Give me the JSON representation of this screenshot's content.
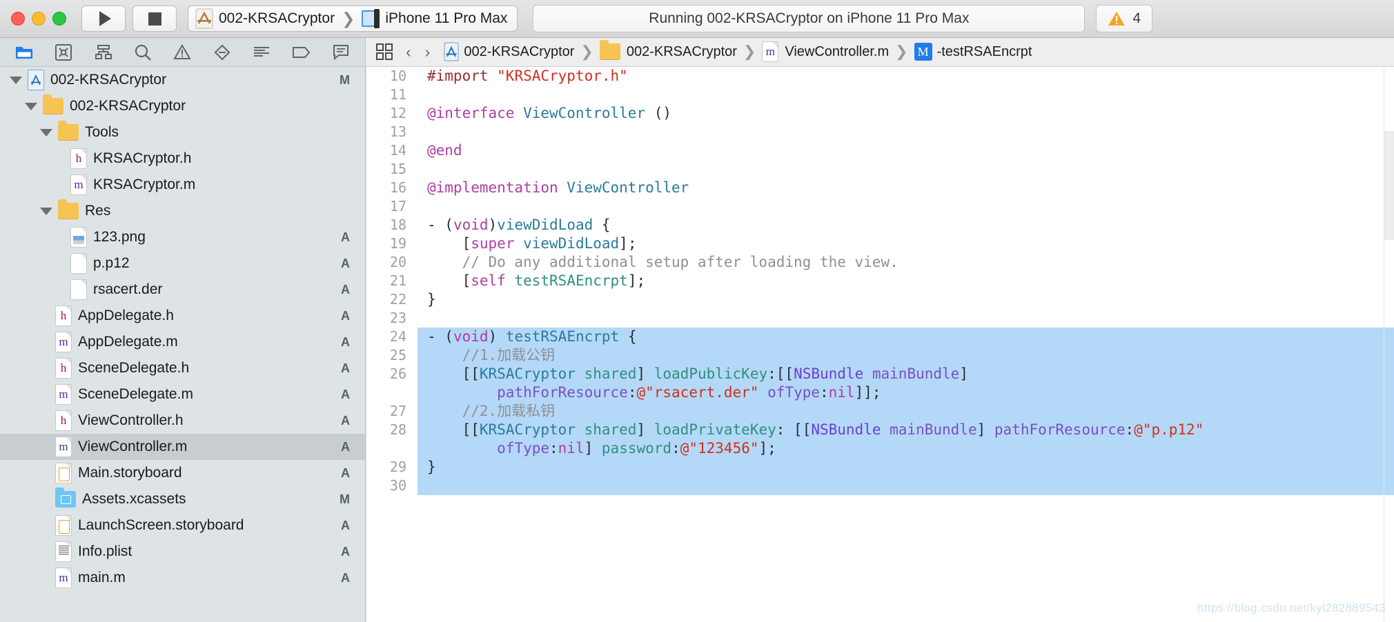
{
  "window": {
    "traffic_lights": [
      "close",
      "minimize",
      "zoom"
    ]
  },
  "toolbar": {
    "run_button": "run",
    "stop_button": "stop",
    "scheme_project": "002-KRSACryptor",
    "scheme_destination": "iPhone 11 Pro Max",
    "status_text": "Running 002-KRSACryptor on iPhone 11 Pro Max",
    "warning_count": "4"
  },
  "navigator_toolbar": {
    "icons": [
      {
        "name": "project-navigator-icon",
        "glyph": "folder",
        "active": true
      },
      {
        "name": "source-control-navigator-icon",
        "glyph": "scm",
        "active": false
      },
      {
        "name": "symbol-navigator-icon",
        "glyph": "hierarchy",
        "active": false
      },
      {
        "name": "find-navigator-icon",
        "glyph": "search",
        "active": false
      },
      {
        "name": "issue-navigator-icon",
        "glyph": "warning",
        "active": false
      },
      {
        "name": "test-navigator-icon",
        "glyph": "diamond",
        "active": false
      },
      {
        "name": "debug-navigator-icon",
        "glyph": "lines",
        "active": false
      },
      {
        "name": "breakpoint-navigator-icon",
        "glyph": "tag",
        "active": false
      },
      {
        "name": "report-navigator-icon",
        "glyph": "speech",
        "active": false
      }
    ]
  },
  "breadcrumb": {
    "back_label": "‹",
    "forward_label": "›",
    "items": [
      {
        "label": "002-KRSACryptor",
        "icon": "xcode-project-icon"
      },
      {
        "label": "002-KRSACryptor",
        "icon": "folder-icon"
      },
      {
        "label": "ViewController.m",
        "icon": "objc-m-file-icon"
      },
      {
        "label": "-testRSAEncrpt",
        "icon": "method-m-icon"
      }
    ]
  },
  "sidebar": {
    "rows": [
      {
        "label": "002-KRSACryptor",
        "indent": 0,
        "icon": "xcode-project-icon",
        "twisty": "open",
        "status": "M"
      },
      {
        "label": "002-KRSACryptor",
        "indent": 1,
        "icon": "folder-icon",
        "twisty": "open",
        "status": ""
      },
      {
        "label": "Tools",
        "indent": 2,
        "icon": "folder-icon",
        "twisty": "open",
        "status": ""
      },
      {
        "label": "KRSACryptor.h",
        "indent": 4,
        "icon": "header-h-file-icon",
        "twisty": "none",
        "status": ""
      },
      {
        "label": "KRSACryptor.m",
        "indent": 4,
        "icon": "objc-m-file-icon",
        "twisty": "none",
        "status": ""
      },
      {
        "label": "Res",
        "indent": 2,
        "icon": "folder-icon",
        "twisty": "open",
        "status": ""
      },
      {
        "label": "123.png",
        "indent": 4,
        "icon": "image-file-icon",
        "twisty": "none",
        "status": "A"
      },
      {
        "label": "p.p12",
        "indent": 4,
        "icon": "generic-file-icon",
        "twisty": "none",
        "status": "A"
      },
      {
        "label": "rsacert.der",
        "indent": 4,
        "icon": "generic-file-icon",
        "twisty": "none",
        "status": "A"
      },
      {
        "label": "AppDelegate.h",
        "indent": 3,
        "icon": "header-h-file-icon",
        "twisty": "none",
        "status": "A"
      },
      {
        "label": "AppDelegate.m",
        "indent": 3,
        "icon": "objc-m-file-icon",
        "twisty": "none",
        "status": "A"
      },
      {
        "label": "SceneDelegate.h",
        "indent": 3,
        "icon": "header-h-file-icon",
        "twisty": "none",
        "status": "A"
      },
      {
        "label": "SceneDelegate.m",
        "indent": 3,
        "icon": "objc-m-file-icon",
        "twisty": "none",
        "status": "A"
      },
      {
        "label": "ViewController.h",
        "indent": 3,
        "icon": "header-h-file-icon",
        "twisty": "none",
        "status": "A"
      },
      {
        "label": "ViewController.m",
        "indent": 3,
        "icon": "objc-m-file-icon",
        "twisty": "none",
        "status": "A",
        "selected": true
      },
      {
        "label": "Main.storyboard",
        "indent": 3,
        "icon": "storyboard-file-icon",
        "twisty": "none",
        "status": "A"
      },
      {
        "label": "Assets.xcassets",
        "indent": 3,
        "icon": "xcassets-folder-icon",
        "twisty": "none",
        "status": "M"
      },
      {
        "label": "LaunchScreen.storyboard",
        "indent": 3,
        "icon": "storyboard-file-icon",
        "twisty": "none",
        "status": "A"
      },
      {
        "label": "Info.plist",
        "indent": 3,
        "icon": "plist-file-icon",
        "twisty": "none",
        "status": "A"
      },
      {
        "label": "main.m",
        "indent": 3,
        "icon": "objc-m-file-icon",
        "twisty": "none",
        "status": "A"
      }
    ]
  },
  "editor": {
    "watermark": "https://blog.csdn.net/kyl282889543",
    "lines": [
      {
        "no": "10",
        "highlighted": false,
        "tokens": [
          {
            "t": "#import ",
            "c": "tok-pre"
          },
          {
            "t": "\"KRSACryptor.h\"",
            "c": "tok-str"
          }
        ]
      },
      {
        "no": "11",
        "highlighted": false,
        "tokens": []
      },
      {
        "no": "12",
        "highlighted": false,
        "tokens": [
          {
            "t": "@interface ",
            "c": "tok-key"
          },
          {
            "t": "ViewController",
            "c": "tok-type"
          },
          {
            "t": " ()",
            "c": "tok-plain"
          }
        ]
      },
      {
        "no": "13",
        "highlighted": false,
        "tokens": []
      },
      {
        "no": "14",
        "highlighted": false,
        "tokens": [
          {
            "t": "@end",
            "c": "tok-key"
          }
        ]
      },
      {
        "no": "15",
        "highlighted": false,
        "tokens": []
      },
      {
        "no": "16",
        "highlighted": false,
        "tokens": [
          {
            "t": "@implementation ",
            "c": "tok-key"
          },
          {
            "t": "ViewController",
            "c": "tok-type"
          }
        ]
      },
      {
        "no": "17",
        "highlighted": false,
        "tokens": []
      },
      {
        "no": "18",
        "highlighted": false,
        "tokens": [
          {
            "t": "- (",
            "c": "tok-plain"
          },
          {
            "t": "void",
            "c": "tok-key"
          },
          {
            "t": ")",
            "c": "tok-plain"
          },
          {
            "t": "viewDidLoad",
            "c": "tok-type"
          },
          {
            "t": " {",
            "c": "tok-plain"
          }
        ]
      },
      {
        "no": "19",
        "highlighted": false,
        "tokens": [
          {
            "t": "    [",
            "c": "tok-plain"
          },
          {
            "t": "super",
            "c": "tok-key"
          },
          {
            "t": " ",
            "c": "tok-plain"
          },
          {
            "t": "viewDidLoad",
            "c": "tok-type"
          },
          {
            "t": "];",
            "c": "tok-plain"
          }
        ]
      },
      {
        "no": "20",
        "highlighted": false,
        "tokens": [
          {
            "t": "    // Do any additional setup after loading the view.",
            "c": "tok-cmt"
          }
        ]
      },
      {
        "no": "21",
        "highlighted": false,
        "tokens": [
          {
            "t": "    [",
            "c": "tok-plain"
          },
          {
            "t": "self",
            "c": "tok-key"
          },
          {
            "t": " ",
            "c": "tok-plain"
          },
          {
            "t": "testRSAEncrpt",
            "c": "tok-meth"
          },
          {
            "t": "];",
            "c": "tok-plain"
          }
        ]
      },
      {
        "no": "22",
        "highlighted": false,
        "tokens": [
          {
            "t": "}",
            "c": "tok-plain"
          }
        ]
      },
      {
        "no": "23",
        "highlighted": false,
        "tokens": []
      },
      {
        "no": "24",
        "highlighted": true,
        "tokens": [
          {
            "t": "- (",
            "c": "tok-plain"
          },
          {
            "t": "void",
            "c": "tok-key"
          },
          {
            "t": ") ",
            "c": "tok-plain"
          },
          {
            "t": "testRSAEncrpt",
            "c": "tok-type"
          },
          {
            "t": " {",
            "c": "tok-plain"
          }
        ]
      },
      {
        "no": "25",
        "highlighted": true,
        "tokens": [
          {
            "t": "    //1.加载公钥",
            "c": "tok-cmt"
          }
        ]
      },
      {
        "no": "26",
        "highlighted": true,
        "tokens": [
          {
            "t": "    [[",
            "c": "tok-plain"
          },
          {
            "t": "KRSACryptor",
            "c": "tok-type"
          },
          {
            "t": " ",
            "c": "tok-plain"
          },
          {
            "t": "shared",
            "c": "tok-meth"
          },
          {
            "t": "] ",
            "c": "tok-plain"
          },
          {
            "t": "loadPublicKey",
            "c": "tok-meth"
          },
          {
            "t": ":[[",
            "c": "tok-plain"
          },
          {
            "t": "NSBundle",
            "c": "tok-cls"
          },
          {
            "t": " ",
            "c": "tok-plain"
          },
          {
            "t": "mainBundle",
            "c": "tok-sel"
          },
          {
            "t": "]",
            "c": "tok-plain"
          }
        ]
      },
      {
        "no": "",
        "highlighted": true,
        "cont": true,
        "tokens": [
          {
            "t": "        ",
            "c": "tok-plain"
          },
          {
            "t": "pathForResource",
            "c": "tok-sel"
          },
          {
            "t": ":",
            "c": "tok-plain"
          },
          {
            "t": "@\"rsacert.der\"",
            "c": "tok-str"
          },
          {
            "t": " ",
            "c": "tok-plain"
          },
          {
            "t": "ofType",
            "c": "tok-sel"
          },
          {
            "t": ":",
            "c": "tok-plain"
          },
          {
            "t": "nil",
            "c": "tok-key"
          },
          {
            "t": "]];",
            "c": "tok-plain"
          }
        ]
      },
      {
        "no": "27",
        "highlighted": true,
        "tokens": [
          {
            "t": "    //2.加载私钥",
            "c": "tok-cmt"
          }
        ]
      },
      {
        "no": "28",
        "highlighted": true,
        "tokens": [
          {
            "t": "    [[",
            "c": "tok-plain"
          },
          {
            "t": "KRSACryptor",
            "c": "tok-type"
          },
          {
            "t": " ",
            "c": "tok-plain"
          },
          {
            "t": "shared",
            "c": "tok-meth"
          },
          {
            "t": "] ",
            "c": "tok-plain"
          },
          {
            "t": "loadPrivateKey",
            "c": "tok-meth"
          },
          {
            "t": ": [[",
            "c": "tok-plain"
          },
          {
            "t": "NSBundle",
            "c": "tok-cls"
          },
          {
            "t": " ",
            "c": "tok-plain"
          },
          {
            "t": "mainBundle",
            "c": "tok-sel"
          },
          {
            "t": "] ",
            "c": "tok-plain"
          },
          {
            "t": "pathForResource",
            "c": "tok-sel"
          },
          {
            "t": ":",
            "c": "tok-plain"
          },
          {
            "t": "@\"p.p12\"",
            "c": "tok-str"
          }
        ]
      },
      {
        "no": "",
        "highlighted": true,
        "cont": true,
        "tokens": [
          {
            "t": "        ",
            "c": "tok-plain"
          },
          {
            "t": "ofType",
            "c": "tok-sel"
          },
          {
            "t": ":",
            "c": "tok-plain"
          },
          {
            "t": "nil",
            "c": "tok-key"
          },
          {
            "t": "] ",
            "c": "tok-plain"
          },
          {
            "t": "password",
            "c": "tok-meth"
          },
          {
            "t": ":",
            "c": "tok-plain"
          },
          {
            "t": "@\"123456\"",
            "c": "tok-str"
          },
          {
            "t": "];",
            "c": "tok-plain"
          }
        ]
      },
      {
        "no": "29",
        "highlighted": true,
        "tokens": [
          {
            "t": "}",
            "c": "tok-plain"
          }
        ]
      },
      {
        "no": "30",
        "highlighted": true,
        "tokens": []
      }
    ]
  },
  "colors": {
    "accent_blue": "#1f7ce8",
    "selection_blue": "#b4d8f8",
    "sidebar_bg": "#dee3e6",
    "warning_yellow": "#f5a623"
  }
}
